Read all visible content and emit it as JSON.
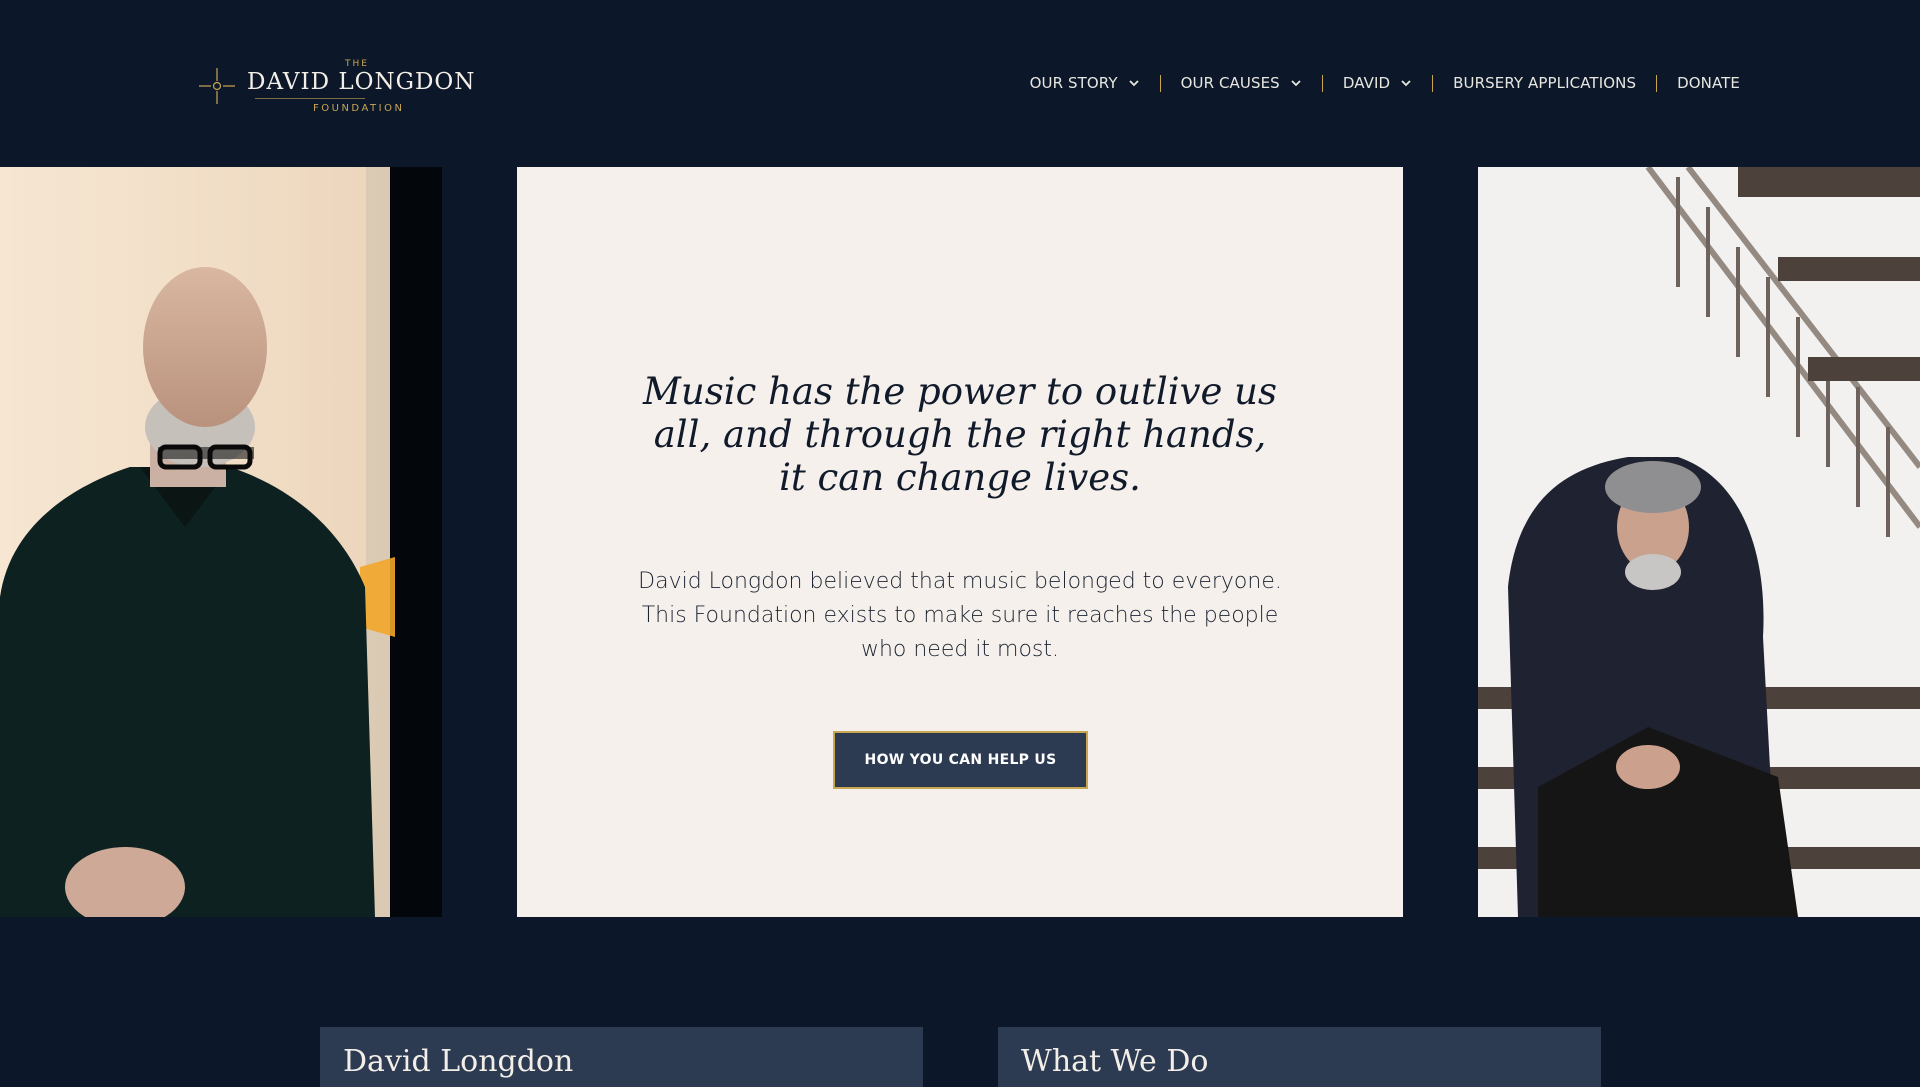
{
  "brand": {
    "the": "THE",
    "name": "DAVID LONGDON",
    "foundation": "FOUNDATION",
    "accent_color": "#c9a652",
    "background_color": "#0c1829"
  },
  "nav": {
    "items": [
      {
        "label": "OUR STORY",
        "has_dropdown": true
      },
      {
        "label": "OUR CAUSES",
        "has_dropdown": true
      },
      {
        "label": "DAVID",
        "has_dropdown": true
      },
      {
        "label": "BURSERY APPLICATIONS",
        "has_dropdown": false
      },
      {
        "label": "DONATE",
        "has_dropdown": false
      }
    ]
  },
  "hero": {
    "quote": "Music has the power to outlive us all, and through the right hands, it can change lives.",
    "intro": "David Longdon believed that music belonged to everyone. This Foundation exists to make sure it reaches the people who need it most.",
    "cta_label": "HOW YOU CAN HELP US",
    "left_photo": "portrait-standing",
    "right_photo": "portrait-seated-on-stairs"
  },
  "cards": [
    {
      "title": "David Longdon"
    },
    {
      "title": "What We Do"
    }
  ]
}
